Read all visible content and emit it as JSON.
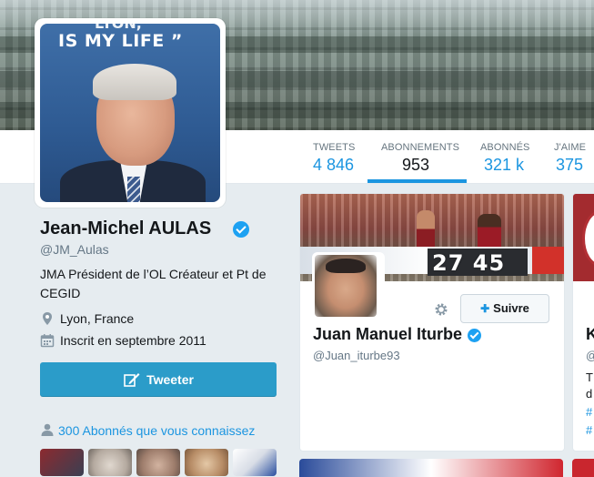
{
  "banner": {
    "quote_top": "LYON,",
    "quote": "IS MY LIFE ”"
  },
  "nav": [
    {
      "label": "TWEETS",
      "value": "4 846"
    },
    {
      "label": "ABONNEMENTS",
      "value": "953"
    },
    {
      "label": "ABONNÉS",
      "value": "321 k"
    },
    {
      "label": "J'AIME",
      "value": "375"
    }
  ],
  "profile": {
    "name": "Jean-Michel AULAS",
    "handle": "@JM_Aulas",
    "bio": "JMA Président de l’OL Créateur et Pt de CEGID",
    "location": "Lyon, France",
    "joined": "Inscrit en septembre 2011",
    "tweet_button": "Tweeter",
    "followers_known": "300 Abonnés que vous connaissez"
  },
  "card": {
    "score_text": "27 45",
    "name": "Juan Manuel Iturbe",
    "handle": "@Juan_iturbe93",
    "follow_label": "Suivre"
  },
  "card2": {
    "name_initial": "K",
    "line1": "@",
    "line2": "T",
    "line3": "d",
    "hash1": "#",
    "hash2": "#"
  },
  "colors": {
    "accent": "#1b95e0",
    "tweet_button": "#2b9cc9",
    "verified": "#1da1f2"
  },
  "icons": {
    "location": "map-pin-icon",
    "joined": "calendar-icon",
    "tweet": "compose-icon",
    "followers": "user-icon",
    "settings": "gear-icon",
    "follow": "add-user-icon"
  }
}
